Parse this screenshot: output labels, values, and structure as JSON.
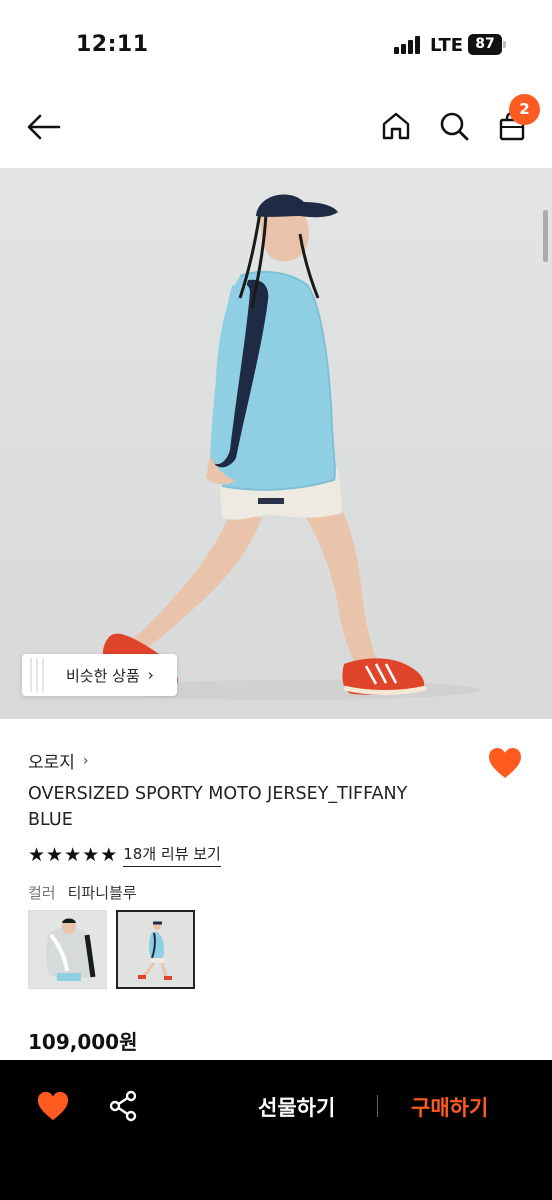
{
  "status_bar": {
    "time": "12:11",
    "network": "LTE",
    "battery": "87"
  },
  "nav": {
    "cart_count": "2"
  },
  "hero": {
    "similar_label": "비슷한 상품"
  },
  "product": {
    "brand": "오로지",
    "name": "OVERSIZED SPORTY MOTO JERSEY_TIFFANY BLUE",
    "rating_stars": 5,
    "review_link": "18개 리뷰 보기",
    "color_label": "컬러",
    "color_value": "티파니블루",
    "price": "109,000원",
    "liked": true
  },
  "bottom_bar": {
    "gift_label": "선물하기",
    "buy_label": "구매하기"
  },
  "colors": {
    "accent": "#ff5a1f",
    "jersey": "#8ecfe4",
    "bar_bg": "#000000"
  },
  "icons": [
    "back-arrow-icon",
    "home-icon",
    "search-icon",
    "cart-icon",
    "heart-icon",
    "share-icon",
    "chevron-right-icon",
    "star-icon"
  ]
}
